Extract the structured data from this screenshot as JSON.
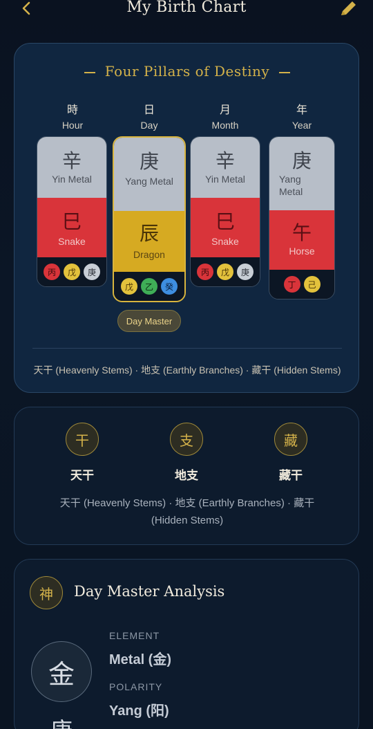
{
  "header": {
    "title": "My Birth Chart",
    "back_icon": "chevron-left-icon",
    "edit_icon": "pencil-icon"
  },
  "four_pillars": {
    "title": "Four Pillars of Destiny",
    "columns": [
      {
        "zh": "時",
        "en": "Hour",
        "stem_char": "辛",
        "stem_label": "Yin Metal",
        "branch_char": "巳",
        "branch_label": "Snake",
        "hidden": [
          "丙",
          "戊",
          "庚"
        ]
      },
      {
        "zh": "日",
        "en": "Day",
        "stem_char": "庚",
        "stem_label": "Yang Metal",
        "branch_char": "辰",
        "branch_label": "Dragon",
        "hidden": [
          "戊",
          "乙",
          "癸"
        ]
      },
      {
        "zh": "月",
        "en": "Month",
        "stem_char": "辛",
        "stem_label": "Yin Metal",
        "branch_char": "巳",
        "branch_label": "Snake",
        "hidden": [
          "丙",
          "戊",
          "庚"
        ]
      },
      {
        "zh": "年",
        "en": "Year",
        "stem_char": "庚",
        "stem_label_1": "Yang",
        "stem_label_2": "Metal",
        "branch_char": "午",
        "branch_label": "Horse",
        "hidden": [
          "丁",
          "己"
        ]
      }
    ],
    "day_master_badge": "Day Master",
    "legend": "天干 (Heavenly Stems) · 地支 (Earthly Branches) · 藏干 (Hidden Stems)"
  },
  "legend_card": {
    "items": [
      {
        "glyph": "干",
        "label": "天干"
      },
      {
        "glyph": "支",
        "label": "地支"
      },
      {
        "glyph": "藏",
        "label": "藏干"
      }
    ],
    "description": "天干 (Heavenly Stems) · 地支 (Earthly Branches) · 藏干 (Hidden Stems)"
  },
  "day_master_analysis": {
    "icon_glyph": "神",
    "title": "Day Master Analysis",
    "element_glyph": "金",
    "stem_glyph": "庚",
    "element_label": "ELEMENT",
    "element_value": "Metal (金)",
    "polarity_label": "POLARITY",
    "polarity_value": "Yang (阳)"
  },
  "colors": {
    "gold": "#d4b24a",
    "fire": "#d9343a",
    "earth": "#d6aa22",
    "metal": "#b7bec8"
  }
}
